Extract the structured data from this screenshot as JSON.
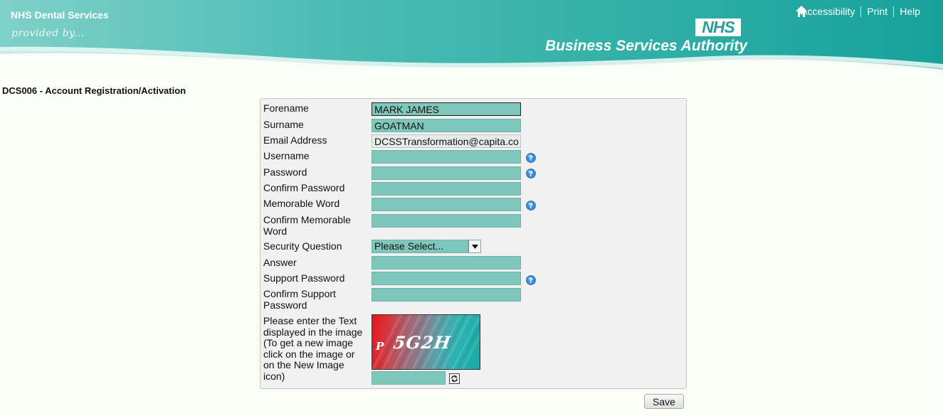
{
  "header": {
    "org_name": "NHS Dental Services",
    "provided_by": "provided by...",
    "links": [
      "Accessibility",
      "Print",
      "Help"
    ],
    "nhs_logo": "NHS",
    "authority": "Business Services Authority",
    "home_icon": "home-icon",
    "colors": {
      "teal": "#3fb5ae",
      "light_teal": "#bfe7e2"
    }
  },
  "page": {
    "title": "DCS006 - Account Registration/Activation"
  },
  "form": {
    "forename_label": "Forename",
    "forename_value": "MARK JAMES",
    "surname_label": "Surname",
    "surname_value": "GOATMAN",
    "email_label": "Email Address",
    "email_value": "DCSSTransformation@capita.co.uk",
    "username_label": "Username",
    "password_label": "Password",
    "confirm_password_label": "Confirm Password",
    "memorable_word_label": "Memorable Word",
    "confirm_memorable_word_label": "Confirm Memorable Word",
    "security_question_label": "Security Question",
    "security_question_selected": "Please Select...",
    "answer_label": "Answer",
    "support_password_label": "Support Password",
    "confirm_support_password_label": "Confirm Support Password",
    "captcha_label": "Please enter the Text displayed in the image (To get a new image click on the image or on the New Image icon)",
    "captcha_small": "P",
    "captcha_main": "5G2H",
    "field_color": "#7fc6bb",
    "help_icon": "help-icon",
    "refresh_icon": "refresh-icon"
  },
  "actions": {
    "save_label": "Save"
  }
}
